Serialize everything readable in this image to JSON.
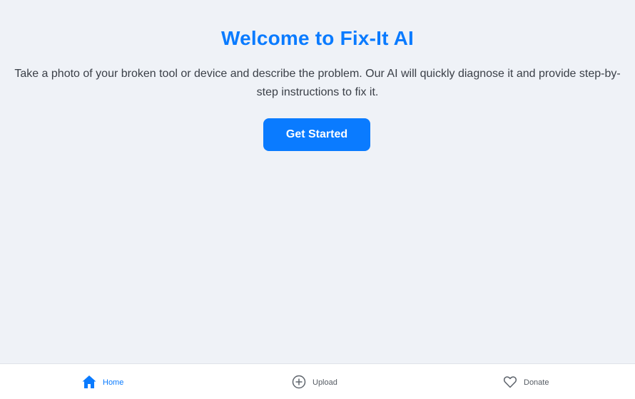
{
  "hero": {
    "title": "Welcome to Fix-It AI",
    "description": "Take a photo of your broken tool or device and describe the problem. Our AI will quickly diagnose it and provide step-by-step instructions to fix it.",
    "cta_label": "Get Started"
  },
  "bottom_nav": {
    "items": [
      {
        "label": "Home",
        "icon": "home-icon",
        "active": true
      },
      {
        "label": "Upload",
        "icon": "plus-circle-icon",
        "active": false
      },
      {
        "label": "Donate",
        "icon": "heart-icon",
        "active": false
      }
    ]
  },
  "colors": {
    "accent": "#0a7bff",
    "background": "#eff2f7",
    "text": "#3a3f47",
    "nav_background": "#ffffff"
  }
}
